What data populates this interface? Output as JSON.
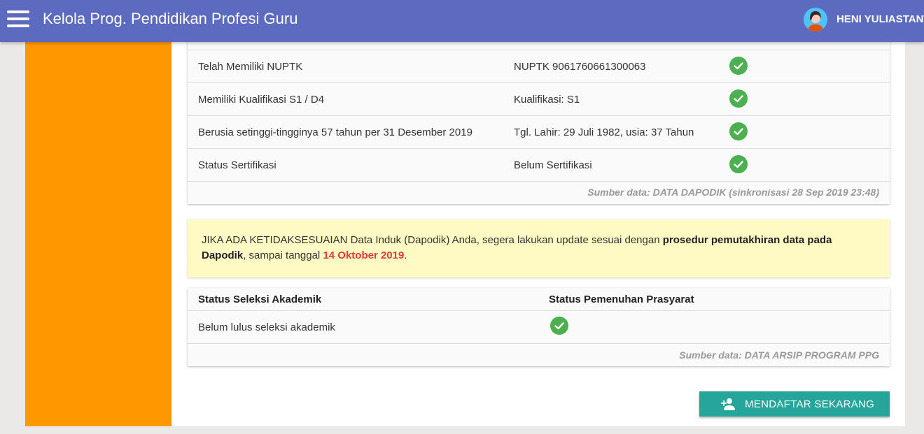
{
  "header": {
    "title": "Kelola Prog. Pendidikan Profesi Guru",
    "user_name": "HENI YULIASTANTI",
    "menu_icon": "hamburger-menu-icon",
    "avatar_icon": "user-avatar-icon"
  },
  "requirements": {
    "rows": [
      {
        "criterion": "Telah Memiliki NUPTK",
        "value": "NUPTK 9061760661300063",
        "status": "check-circle-icon"
      },
      {
        "criterion": "Memiliki Kualifikasi S1 / D4",
        "value": "Kualifikasi: S1",
        "status": "check-circle-icon"
      },
      {
        "criterion": "Berusia setinggi-tingginya 57 tahun per 31 Desember 2019",
        "value": "Tgl. Lahir: 29 Juli 1982, usia: 37 Tahun",
        "status": "check-circle-icon"
      },
      {
        "criterion": "Status Sertifikasi",
        "value": "Belum Sertifikasi",
        "status": "check-circle-icon"
      }
    ],
    "source": "Sumber data: DATA DAPODIK (sinkronisasi 28 Sep 2019 23:48)"
  },
  "notice": {
    "part1": "JIKA ADA KETIDAKSESUAIAN Data Induk (Dapodik) Anda, segera lakukan update sesuai dengan ",
    "bold": "prosedur pemutakhiran data pada Dapodik",
    "part2": ", sampai tanggal ",
    "date": "14 Oktober 2019",
    "part3": ".",
    "date_color": "#e53935",
    "background": "#fff9c4"
  },
  "academic": {
    "col1_header": "Status Seleksi Akademik",
    "col2_header": "Status Pemenuhan Prasyarat",
    "row": {
      "status": "Belum lulus seleksi akademik",
      "prerequisite": "check-circle-icon"
    },
    "source": "Sumber data: DATA ARSIP PROGRAM PPG"
  },
  "actions": {
    "register_label": "MENDAFTAR SEKARANG",
    "register_icon": "person-add-icon"
  },
  "colors": {
    "topbar": "#5c6bc0",
    "side_panel": "#ff9800",
    "check": "#4caf50",
    "button": "#26a69a"
  }
}
